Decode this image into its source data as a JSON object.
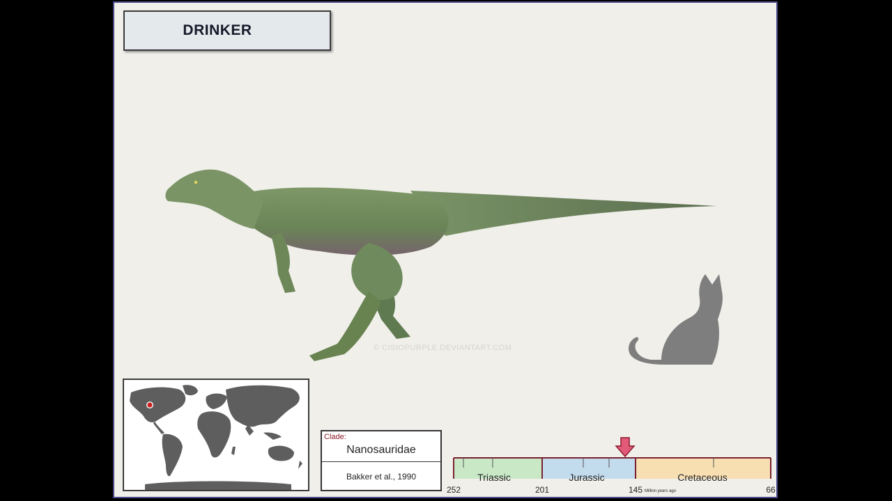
{
  "title": "DRINKER",
  "watermark": "© CISIOPURPLE.DEVIANTART.COM",
  "clade": {
    "label": "Clade:",
    "name": "Nanosauridae",
    "authority": "Bakker et al., 1990"
  },
  "timeline": {
    "unit": "Million years ago",
    "ticks": [
      "252",
      "201",
      "145",
      "66"
    ],
    "periods": [
      {
        "name": "Triassic",
        "start": 252,
        "end": 201,
        "color": "#c8e8c6"
      },
      {
        "name": "Jurassic",
        "start": 201,
        "end": 145,
        "color": "#c2dcee"
      },
      {
        "name": "Cretaceous",
        "start": 145,
        "end": 66,
        "color": "#f7dfb2"
      }
    ],
    "marker": {
      "value": 145,
      "color": "#e25a78"
    }
  },
  "map": {
    "location_marker_color": "#cc1f1f",
    "land_color": "#5e5e5e"
  },
  "colors": {
    "frame_border": "#4b4a8c",
    "card_background": "#f0efea",
    "dinosaur": "#6f8a5c",
    "cat_silhouette": "#7e7e7e"
  }
}
